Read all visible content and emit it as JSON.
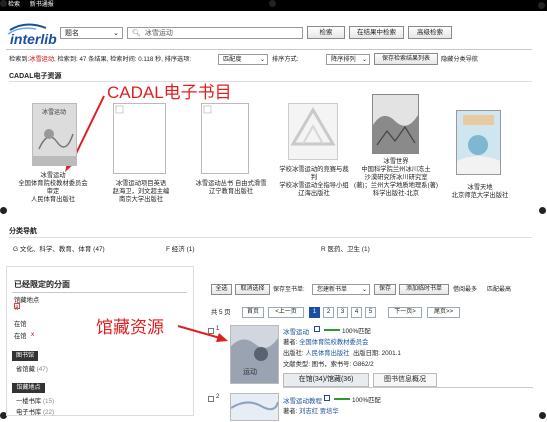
{
  "topbar": {
    "item1": "检索",
    "item2": "新书通报"
  },
  "logo": {
    "text": "interlib"
  },
  "search": {
    "field_select": "题名",
    "query": "冰雪运动",
    "search_btn": "检索",
    "search_in_results_btn": "在结果中检索",
    "advanced_btn": "高级检索"
  },
  "results_bar": {
    "prefix": "检索到:",
    "query_term": "冰雪运动",
    "summary": ", 检索到: 47 条结果, 检索时间: 0.118 秒, 排序选项:",
    "sort_select": "匹配度",
    "order_label": "排序方式:",
    "order_select": "降序排列",
    "save_conditions_btn": "保存检索结果列表",
    "hide_nav_text": "隐藏分类导航"
  },
  "cadal": {
    "heading": "CADAL电子资源",
    "annotation": "CADAL电子书目",
    "books": [
      {
        "line1": "冰雪运动",
        "line2": "全国体育院校教材委员会",
        "line3": "审定",
        "line4": "人民体育出版社"
      },
      {
        "line1": "冰雪运动项目英语",
        "line2": "赵海卫，刘文超主编",
        "line3": "南京大学出版社",
        "line4": ""
      },
      {
        "line1": "冰雪运动丛书 自由式滑雪",
        "line2": "辽宁教育出版社",
        "line3": "",
        "line4": ""
      },
      {
        "line1": "学校冰雪运动的竞赛与裁",
        "line2": "判",
        "line3": "学校冰雪运动全指导小组",
        "line4": "辽海出版社"
      },
      {
        "line1": "冰雪世界",
        "line2": "中国科学院兰州冰川冻土",
        "line3": "沙漠研究所冰川研究室",
        "line4": "(著)；兰州大学地质地理系(著)",
        "line5": "科学出版社-北京"
      },
      {
        "line1": "冰雪天地",
        "line2": "北京师范大学出版社",
        "line3": "",
        "line4": ""
      }
    ]
  },
  "category_nav": {
    "heading": "分类导航",
    "items": [
      "G 文化、科学、教育、体育 (47)",
      "F 经济 (1)",
      "R 医药、卫生 (1)"
    ]
  },
  "sidebar": {
    "heading": "已经限定的分面",
    "filter1_label": "馆藏地点",
    "filter1_x": "x",
    "filter2_label": "在馆",
    "filter2_x": "x",
    "filter3_label": "在馆",
    "filter3_x": "x",
    "section1": "图书馆",
    "section1_item": "省馆藏",
    "section1_count": "(47)",
    "section2": "馆藏地点",
    "section2_items": [
      {
        "name": "一楼书库",
        "count": "(15)"
      },
      {
        "name": "电子书库",
        "count": "(22)"
      }
    ]
  },
  "toolbar": {
    "select_all": "全选",
    "cancel_select": "取消选择",
    "save_to_label": "保存至书单:",
    "booklist_select": "您建新书单",
    "save_btn": "保存",
    "add_temp_btn": "添加临时书单",
    "borrow_most": "借阅最多",
    "match_most": "匹配最高"
  },
  "pagination": {
    "total_label": "共 5 页",
    "first": "首页",
    "prev": "<上一页",
    "pages": [
      "1",
      "2",
      "3",
      "4",
      "5"
    ],
    "next": "下一页>",
    "last": "尾页>>"
  },
  "holdings_annotation": "馆藏资源",
  "records": [
    {
      "index": "1",
      "title": "冰雪运动",
      "match": "100%匹配",
      "author_label": "著者:",
      "author": "全国体育院校教材委员会",
      "publisher_label": "出版社:",
      "publisher": "人民体育出版社",
      "year_label": "出版日期:",
      "year": "2001.1",
      "doctype_label": "文献类型:",
      "doctype": "图书，索书号: G862/2",
      "tab1": "在馆(34)/馆藏(36)",
      "tab2": "图书信息概况"
    },
    {
      "index": "2",
      "title": "冰雪运动教程",
      "match": "100%匹配",
      "author_label": "著者:",
      "author": "刘志红 贾培华"
    }
  ],
  "colors": {
    "accent_blue": "#1a4fa0",
    "match_green": "#2e9a2e",
    "annotation_red": "#e02020"
  }
}
